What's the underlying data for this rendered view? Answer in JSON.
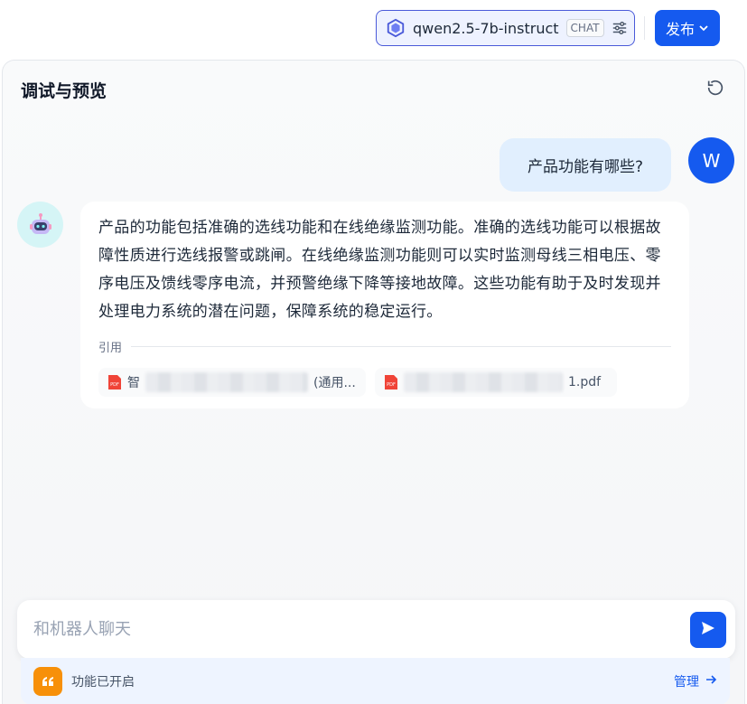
{
  "header": {
    "model_name": "qwen2.5-7b-instruct",
    "model_mode": "CHAT",
    "publish_label": "发布",
    "icons": {
      "model": "model-logo-icon",
      "settings": "tune-icon",
      "publish": "chevron-down-icon"
    }
  },
  "panel": {
    "title": "调试与预览"
  },
  "conversation": {
    "user_avatar_initial": "W",
    "user_message": "产品功能有哪些?",
    "bot_message": "产品的功能包括准确的选线功能和在线绝缘监测功能。准确的选线功能可以根据故障性质进行选线报警或跳闸。在线绝缘监测功能则可以实时监测母线三相电压、零序电压及馈线零序电流，并预警绝缘下降等接地故障。这些功能有助于及时发现并处理电力系统的潜在问题，保障系统的稳定运行。",
    "citation_label": "引用",
    "citations": [
      {
        "prefix": "智",
        "suffix": "(通用..."
      },
      {
        "prefix": "",
        "suffix": "1.pdf"
      }
    ]
  },
  "composer": {
    "placeholder": "和机器人聊天"
  },
  "features": {
    "status_text": "功能已开启",
    "manage_label": "管理"
  },
  "colors": {
    "accent": "#155aef",
    "user_bubble": "#e1effe",
    "feature_icon": "#f79009"
  }
}
